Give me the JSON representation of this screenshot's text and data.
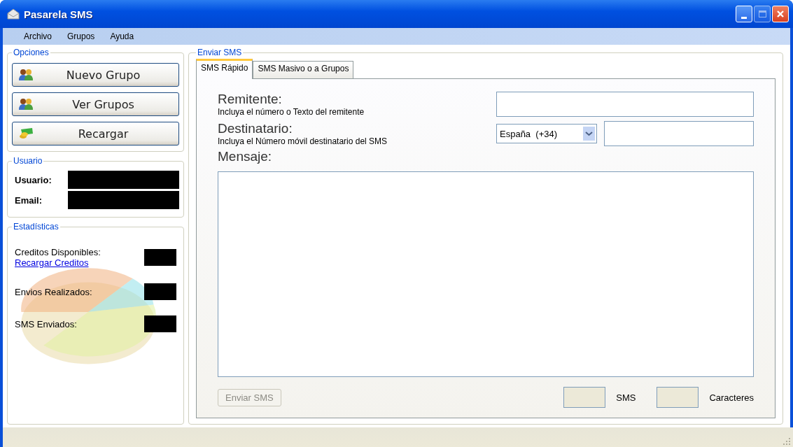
{
  "window": {
    "title": "Pasarela SMS"
  },
  "menu": [
    "Archivo",
    "Grupos",
    "Ayuda"
  ],
  "opciones": {
    "title": "Opciones",
    "buttons": [
      {
        "label": "Nuevo Grupo",
        "kind": "group"
      },
      {
        "label": "Ver Grupos",
        "kind": "group"
      },
      {
        "label": "Recargar",
        "kind": "money"
      }
    ]
  },
  "usuario": {
    "title": "Usuario",
    "fields": [
      {
        "label": "Usuario:"
      },
      {
        "label": "Email:"
      }
    ]
  },
  "estadisticas": {
    "title": "Estadísticas",
    "rows": [
      {
        "label": "Creditos Disponibles:",
        "link": "Recargar Creditos"
      },
      {
        "label": "Envios Realizados:"
      },
      {
        "label": "SMS Enviados:"
      }
    ]
  },
  "enviar": {
    "title": "Enviar SMS",
    "tabs": [
      {
        "label": "SMS Rápido",
        "selected": true
      },
      {
        "label": "SMS Masivo o a Grupos",
        "selected": false
      }
    ],
    "remitente": {
      "label": "Remitente:",
      "hint": "Incluya el número o Texto del remitente"
    },
    "destinatario": {
      "label": "Destinatario:",
      "hint": "Incluya el Número móvil destinatario del SMS",
      "country": "España  (+34)"
    },
    "mensaje": {
      "label": "Mensaje:"
    },
    "send_button": {
      "label": "Enviar SMS",
      "disabled": true
    },
    "counters": [
      {
        "label": "SMS"
      },
      {
        "label": "Caracteres"
      }
    ]
  }
}
